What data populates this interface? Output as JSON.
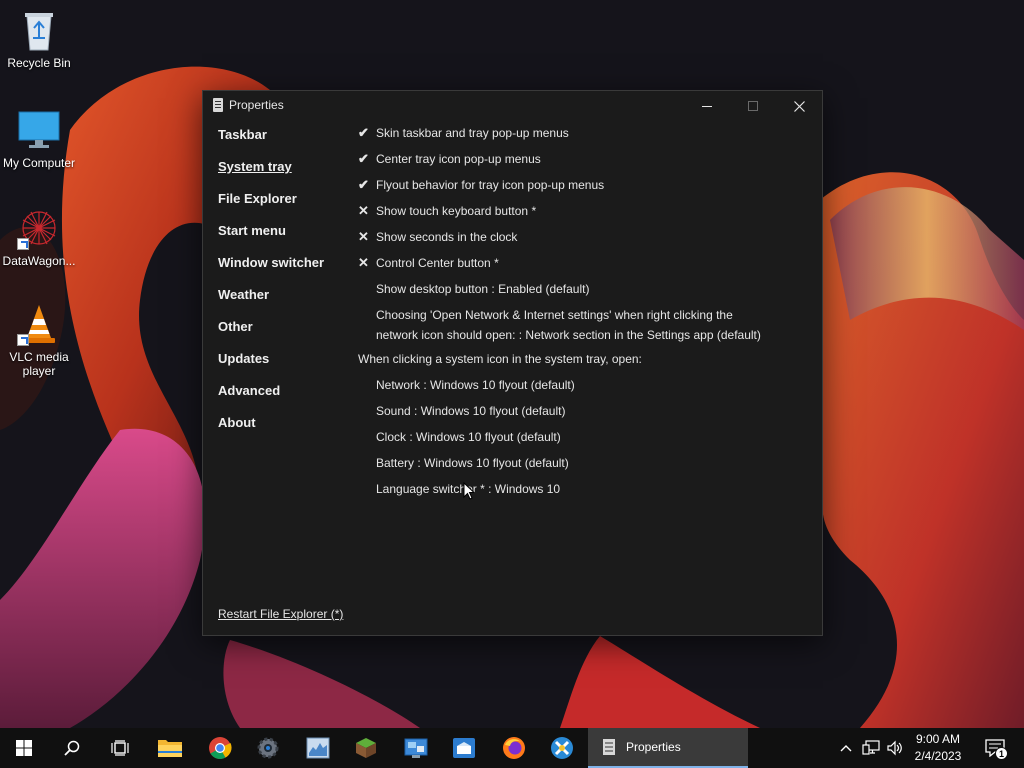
{
  "desktop": {
    "icons": [
      {
        "label": "Recycle Bin",
        "icon": "recycle-bin-icon"
      },
      {
        "label": "My Computer",
        "icon": "monitor-icon"
      },
      {
        "label": "DataWagon...",
        "icon": "datawagon-icon"
      },
      {
        "label": "VLC media player",
        "icon": "vlc-cone-icon"
      }
    ]
  },
  "window": {
    "title": "Properties",
    "nav": [
      {
        "label": "Taskbar",
        "active": false
      },
      {
        "label": "System tray",
        "active": true
      },
      {
        "label": "File Explorer",
        "active": false
      },
      {
        "label": "Start menu",
        "active": false
      },
      {
        "label": "Window switcher",
        "active": false
      },
      {
        "label": "Weather",
        "active": false
      },
      {
        "label": "Other",
        "active": false
      },
      {
        "label": "Updates",
        "active": false
      },
      {
        "label": "Advanced",
        "active": false
      },
      {
        "label": "About",
        "active": false
      }
    ],
    "options": [
      {
        "mark": "✔",
        "label": "Skin taskbar and tray pop-up menus"
      },
      {
        "mark": "✔",
        "label": "Center tray icon pop-up menus"
      },
      {
        "mark": "✔",
        "label": "Flyout behavior for tray icon pop-up menus"
      },
      {
        "mark": "✕",
        "label": "Show touch keyboard button *"
      },
      {
        "mark": "✕",
        "label": "Show seconds in the clock"
      },
      {
        "mark": "✕",
        "label": "Control Center button *"
      },
      {
        "mark": "",
        "label": "Show desktop button : Enabled (default)"
      }
    ],
    "network_option": {
      "line1": "Choosing 'Open Network & Internet settings' when right clicking the",
      "line2": "network icon should open: : Network section in the Settings app (default)"
    },
    "section_heading": "When clicking a system icon in the system tray, open:",
    "sub_options": [
      "Network : Windows 10 flyout (default)",
      "Sound : Windows 10 flyout (default)",
      "Clock : Windows 10 flyout (default)",
      "Battery : Windows 10 flyout (default)",
      "Language switcher * : Windows 10"
    ],
    "restart_link": "Restart File Explorer (*)"
  },
  "taskbar": {
    "active_window_label": "Properties",
    "time": "9:00 AM",
    "date": "2/4/2023",
    "notification_count": "1"
  },
  "colors": {
    "window_bg": "#1b1b1b",
    "taskbar_bg": "#101010",
    "accent": "#7fb2e8"
  }
}
